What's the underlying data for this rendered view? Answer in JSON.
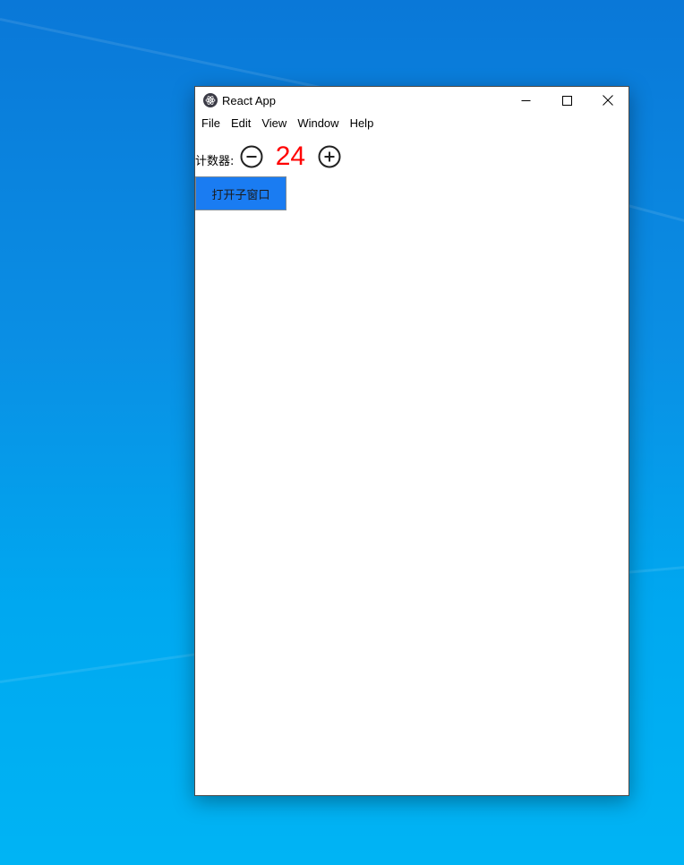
{
  "window": {
    "title": "React App",
    "app_icon": "electron-atom-icon",
    "controls": {
      "minimize_icon": "minimize-icon",
      "maximize_icon": "maximize-icon",
      "close_icon": "close-icon"
    }
  },
  "menu": {
    "items": [
      {
        "label": "File"
      },
      {
        "label": "Edit"
      },
      {
        "label": "View"
      },
      {
        "label": "Window"
      },
      {
        "label": "Help"
      }
    ]
  },
  "counter": {
    "label": "计数器:",
    "value": "24",
    "decrement_icon": "minus-circle-icon",
    "increment_icon": "plus-circle-icon",
    "value_color": "#ff0000"
  },
  "actions": {
    "open_child_window_label": "打开子窗口",
    "button_color": "#1a7cf2"
  },
  "desktop": {
    "background_color": "#0a8fe4"
  }
}
